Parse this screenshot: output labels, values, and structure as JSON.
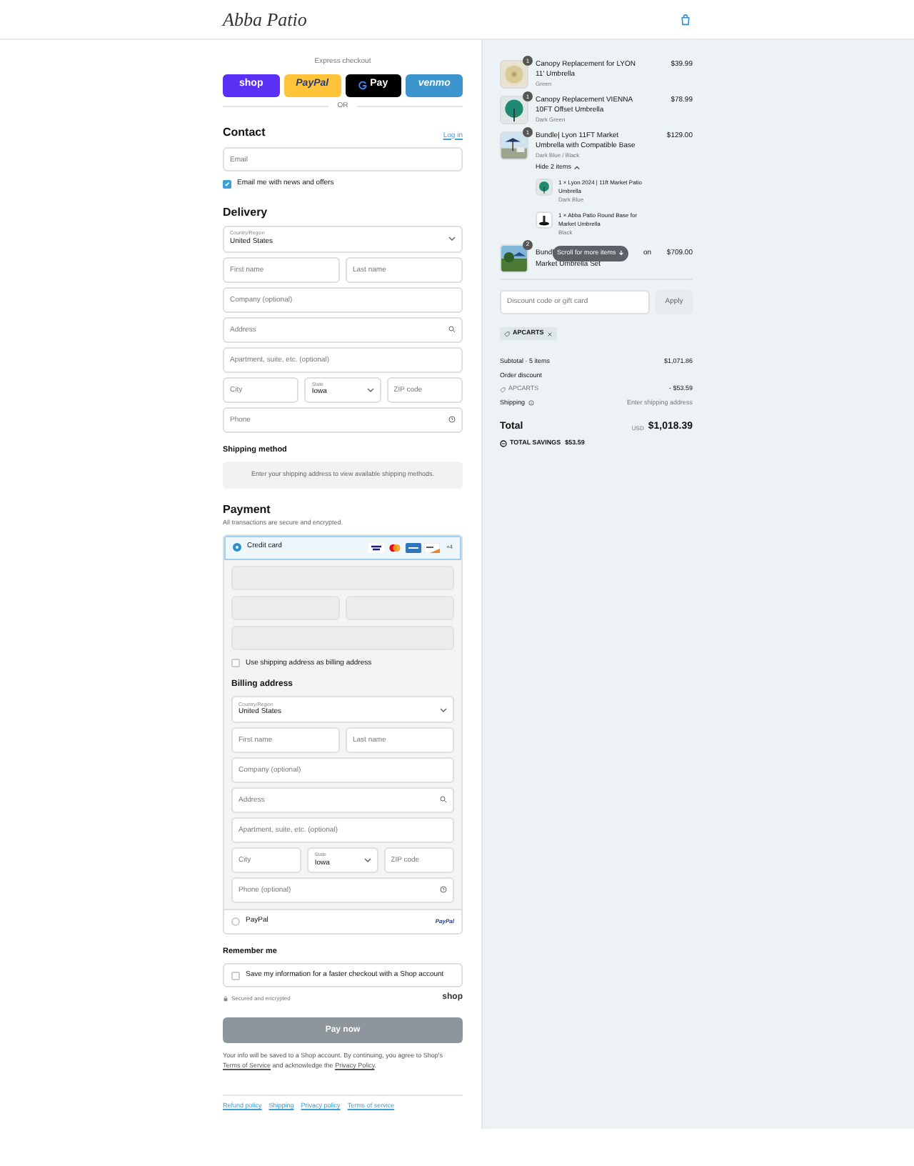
{
  "header": {
    "logo": "Abba Patio"
  },
  "express": {
    "label": "Express checkout",
    "buttons": [
      {
        "kind": "shop",
        "label": "shop"
      },
      {
        "kind": "paypal",
        "label": "PayPal"
      },
      {
        "kind": "gpay",
        "label": "Pay"
      },
      {
        "kind": "venmo",
        "label": "venmo"
      }
    ],
    "divider": "OR"
  },
  "contact": {
    "title": "Contact",
    "login_link": "Log in",
    "email": {
      "kind": "text",
      "placeholder": "Email"
    },
    "newsletter": {
      "label": "Email me with news and offers",
      "checked": true
    }
  },
  "delivery": {
    "title": "Delivery",
    "rows": [
      [
        {
          "kind": "select",
          "label": "Country/Region",
          "value": "United States"
        }
      ],
      [
        {
          "kind": "text",
          "placeholder": "First name"
        },
        {
          "kind": "text",
          "placeholder": "Last name"
        }
      ],
      [
        {
          "kind": "text",
          "placeholder": "Company (optional)"
        }
      ],
      [
        {
          "kind": "search",
          "placeholder": "Address"
        }
      ],
      [
        {
          "kind": "text",
          "placeholder": "Apartment, suite, etc. (optional)"
        }
      ],
      [
        {
          "kind": "text",
          "placeholder": "City"
        },
        {
          "kind": "select",
          "label": "State",
          "value": "Iowa"
        },
        {
          "kind": "text",
          "placeholder": "ZIP code"
        }
      ],
      [
        {
          "kind": "help",
          "placeholder": "Phone"
        }
      ]
    ]
  },
  "shipping": {
    "title": "Shipping method",
    "notice": "Enter your shipping address to view available shipping methods."
  },
  "payment": {
    "title": "Payment",
    "subtitle": "All transactions are secure and encrypted.",
    "card": {
      "label": "Credit card",
      "selected": true,
      "more_cards": "+4"
    },
    "billing_toggle": {
      "label": "Use shipping address as billing address",
      "checked": false
    },
    "billing": {
      "title": "Billing address",
      "rows": [
        [
          {
            "kind": "select",
            "label": "Country/Region",
            "value": "United States"
          }
        ],
        [
          {
            "kind": "text",
            "placeholder": "First name"
          },
          {
            "kind": "text",
            "placeholder": "Last name"
          }
        ],
        [
          {
            "kind": "text",
            "placeholder": "Company (optional)"
          }
        ],
        [
          {
            "kind": "search",
            "placeholder": "Address"
          }
        ],
        [
          {
            "kind": "text",
            "placeholder": "Apartment, suite, etc. (optional)"
          }
        ],
        [
          {
            "kind": "text",
            "placeholder": "City"
          },
          {
            "kind": "select",
            "label": "State",
            "value": "Iowa"
          },
          {
            "kind": "text",
            "placeholder": "ZIP code"
          }
        ],
        [
          {
            "kind": "help",
            "placeholder": "Phone (optional)"
          }
        ]
      ]
    },
    "paypal": {
      "label": "PayPal",
      "selected": false,
      "logo": "PayPal"
    }
  },
  "remember": {
    "title": "Remember me",
    "checkbox": {
      "label": "Save my information for a faster checkout with a Shop account",
      "checked": false
    },
    "secured": "Secured and encrypted",
    "shop_logo": "shop"
  },
  "pay_button": {
    "label": "Pay now",
    "disabled": true
  },
  "legal": [
    {
      "text": "Your info will be saved to a Shop account. By continuing, you agree to Shop's "
    },
    {
      "link": "Terms of Service"
    },
    {
      "text": " and acknowledge the "
    },
    {
      "link": "Privacy Policy"
    },
    {
      "text": "."
    }
  ],
  "footer_links": [
    "Refund policy",
    "Shipping",
    "Privacy policy",
    "Terms of service"
  ],
  "summary": {
    "items": [
      {
        "kind": "canopy",
        "quantity": "1",
        "title": "Canopy Replacement for LYON 11' Umbrella",
        "variant": "Green",
        "price": "$39.99"
      },
      {
        "kind": "umbrella",
        "quantity": "1",
        "title": "Canopy Replacement VIENNA 10FT Offset Umbrella",
        "variant": "Dark Green",
        "price": "$78.99"
      },
      {
        "kind": "patio",
        "quantity": "1",
        "title": "Bundle| Lyon 11FT Market Umbrella with Compatible Base",
        "variant": "Dark Blue / Black",
        "price": "$129.00",
        "toggle": "Hide 2 items",
        "expanded": true,
        "children": [
          {
            "kind": "umbrella",
            "title": "1 × Lyon 2024 | 11ft Market Patio Umbrella",
            "variant": "Dark Blue"
          },
          {
            "kind": "base",
            "title": "1 × Abba Patio Round Base for Market Umbrella",
            "variant": "Black"
          }
        ]
      },
      {
        "kind": "garden",
        "quantity": "2",
        "title_start": "Bundl",
        "title_end": "on",
        "title_line2": "Market Umbrella Set",
        "price": "$709.00"
      }
    ],
    "scroll_hint": "Scroll for more items",
    "discount": {
      "placeholder": "Discount code or gift card",
      "button": "Apply",
      "tag": "APCARTS"
    },
    "subtotal": {
      "label": "Subtotal · 5 items",
      "value": "$1,071.86"
    },
    "order_discount": {
      "label": "Order discount",
      "code": "APCARTS",
      "value": "- $53.59"
    },
    "shipping": {
      "label": "Shipping",
      "value": "Enter shipping address"
    },
    "total": {
      "label": "Total",
      "currency": "USD",
      "value": "$1,018.39"
    },
    "savings": {
      "label": "TOTAL SAVINGS",
      "value": "$53.59"
    }
  }
}
